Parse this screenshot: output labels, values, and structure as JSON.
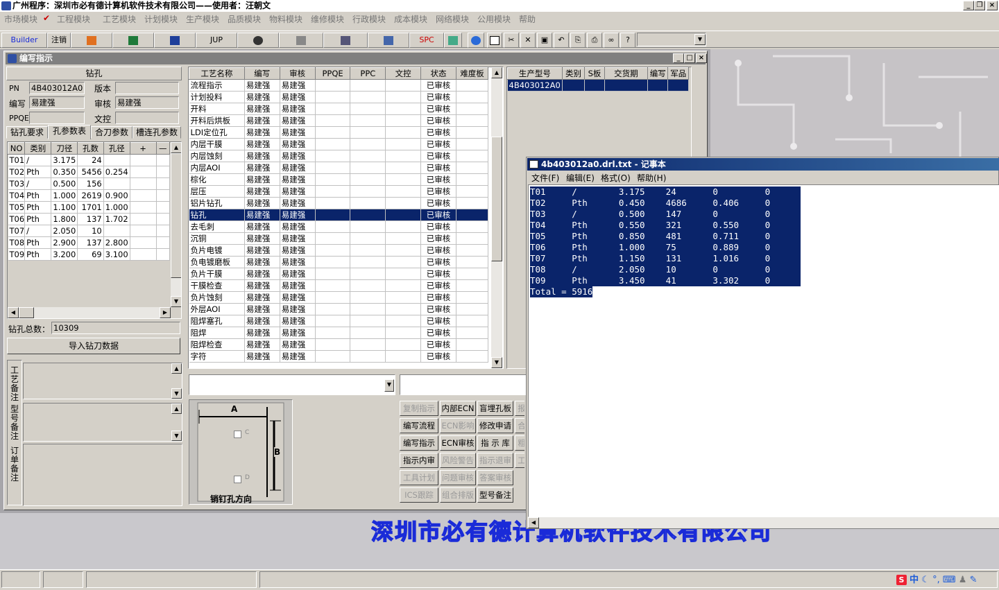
{
  "app_title": "广州程序：深圳市必有德计算机软件技术有限公司——使用者：汪朝文",
  "menu": [
    "市场模块",
    "工程模块",
    "工艺模块",
    "计划模块",
    "生产模块",
    "品质模块",
    "物料模块",
    "维修模块",
    "行政模块",
    "成本模块",
    "网络模块",
    "公用模块",
    "帮助"
  ],
  "toolbar": {
    "builder": "Builder",
    "logout": "注销",
    "jup": "JUP",
    "spc": "SPC"
  },
  "child_title": "编写指示",
  "left": {
    "section_title": "钻孔",
    "pn_label": "PN",
    "pn_value": "4B403012A0",
    "version_label": "版本",
    "version_value": "",
    "writer_label": "编写",
    "writer_value": "易建强",
    "reviewer_label": "审核",
    "reviewer_value": "易建强",
    "ppqe_label": "PPQE",
    "ppqe_value": "",
    "wenkong_label": "文控",
    "wenkong_value": "",
    "tabs": [
      "钻孔要求",
      "孔参数表",
      "合刀参数",
      "槽连孔参数"
    ],
    "table_headers": [
      "NO",
      "类别",
      "刀径",
      "孔数",
      "孔径",
      "+",
      "—"
    ],
    "rows": [
      [
        "T01",
        "/",
        "3.175",
        "24",
        ""
      ],
      [
        "T02",
        "Pth",
        "0.350",
        "5456",
        "0.254"
      ],
      [
        "T03",
        "/",
        "0.500",
        "156",
        ""
      ],
      [
        "T04",
        "Pth",
        "1.000",
        "2619",
        "0.900"
      ],
      [
        "T05",
        "Pth",
        "1.100",
        "1701",
        "1.000"
      ],
      [
        "T06",
        "Pth",
        "1.800",
        "137",
        "1.702"
      ],
      [
        "T07",
        "/",
        "2.050",
        "10",
        ""
      ],
      [
        "T08",
        "Pth",
        "2.900",
        "137",
        "2.800"
      ],
      [
        "T09",
        "Pth",
        "3.200",
        "69",
        "3.100"
      ]
    ],
    "total_label": "钻孔总数：",
    "total_value": "10309",
    "import_button": "导入钻刀数据",
    "note_labels": [
      "工艺备注",
      "型号备注",
      "订单备注"
    ]
  },
  "process": {
    "headers": [
      "工艺名称",
      "编写",
      "审核",
      "PPQE",
      "PPC",
      "文控",
      "状态",
      "难度板"
    ],
    "rows": [
      [
        "流程指示",
        "易建强",
        "易建强",
        "",
        "",
        "",
        "已审核",
        ""
      ],
      [
        "计划投料",
        "易建强",
        "易建强",
        "",
        "",
        "",
        "已审核",
        ""
      ],
      [
        "开料",
        "易建强",
        "易建强",
        "",
        "",
        "",
        "已审核",
        ""
      ],
      [
        "开料后烘板",
        "易建强",
        "易建强",
        "",
        "",
        "",
        "已审核",
        ""
      ],
      [
        "LDI定位孔",
        "易建强",
        "易建强",
        "",
        "",
        "",
        "已审核",
        ""
      ],
      [
        "内层干膜",
        "易建强",
        "易建强",
        "",
        "",
        "",
        "已审核",
        ""
      ],
      [
        "内层蚀刻",
        "易建强",
        "易建强",
        "",
        "",
        "",
        "已审核",
        ""
      ],
      [
        "内层AOI",
        "易建强",
        "易建强",
        "",
        "",
        "",
        "已审核",
        ""
      ],
      [
        "棕化",
        "易建强",
        "易建强",
        "",
        "",
        "",
        "已审核",
        ""
      ],
      [
        "层压",
        "易建强",
        "易建强",
        "",
        "",
        "",
        "已审核",
        ""
      ],
      [
        "铝片钻孔",
        "易建强",
        "易建强",
        "",
        "",
        "",
        "已审核",
        ""
      ],
      [
        "钻孔",
        "易建强",
        "易建强",
        "",
        "",
        "",
        "已审核",
        ""
      ],
      [
        "去毛刺",
        "易建强",
        "易建强",
        "",
        "",
        "",
        "已审核",
        ""
      ],
      [
        "沉铜",
        "易建强",
        "易建强",
        "",
        "",
        "",
        "已审核",
        ""
      ],
      [
        "负片电镀",
        "易建强",
        "易建强",
        "",
        "",
        "",
        "已审核",
        ""
      ],
      [
        "负电镀磨板",
        "易建强",
        "易建强",
        "",
        "",
        "",
        "已审核",
        ""
      ],
      [
        "负片干膜",
        "易建强",
        "易建强",
        "",
        "",
        "",
        "已审核",
        ""
      ],
      [
        "干膜检查",
        "易建强",
        "易建强",
        "",
        "",
        "",
        "已审核",
        ""
      ],
      [
        "负片蚀刻",
        "易建强",
        "易建强",
        "",
        "",
        "",
        "已审核",
        ""
      ],
      [
        "外层AOI",
        "易建强",
        "易建强",
        "",
        "",
        "",
        "已审核",
        ""
      ],
      [
        "阻焊塞孔",
        "易建强",
        "易建强",
        "",
        "",
        "",
        "已审核",
        ""
      ],
      [
        "阻焊",
        "易建强",
        "易建强",
        "",
        "",
        "",
        "已审核",
        ""
      ],
      [
        "阻焊检查",
        "易建强",
        "易建强",
        "",
        "",
        "",
        "已审核",
        ""
      ],
      [
        "字符",
        "易建强",
        "易建强",
        "",
        "",
        "",
        "已审核",
        ""
      ]
    ],
    "selected_index": 11
  },
  "orders": {
    "headers": [
      "生产型号",
      "类别",
      "S板",
      "交货期",
      "编写",
      "军品"
    ],
    "rows": [
      [
        "4B403012A0",
        "",
        "",
        "",
        "",
        ""
      ]
    ]
  },
  "diagram": {
    "label_a": "A",
    "label_b": "B",
    "check_c": "C",
    "check_d": "D",
    "caption": "销钉孔方向"
  },
  "action_buttons": [
    [
      "复制指示",
      "内部ECN",
      "盲埋孔板",
      "报"
    ],
    [
      "编写流程",
      "ECN影响",
      "修改申请",
      "合"
    ],
    [
      "编写指示",
      "ECN审核",
      "指 示 库",
      "粗"
    ],
    [
      "指示内审",
      "风险警告",
      "指示退审",
      "工"
    ],
    [
      "工具计划",
      "问题审核",
      "答案审核",
      ""
    ],
    [
      "ICS跟踪",
      "组合排版",
      "型号备注",
      ""
    ]
  ],
  "action_disabled": [
    [
      true,
      false,
      false,
      true
    ],
    [
      false,
      true,
      false,
      true
    ],
    [
      false,
      false,
      false,
      true
    ],
    [
      false,
      true,
      true,
      true
    ],
    [
      true,
      true,
      true,
      false
    ],
    [
      true,
      true,
      false,
      false
    ]
  ],
  "company_banner": "深圳市必有德计算机软件技术有限公司",
  "notepad": {
    "title": "4b403012a0.drl.txt - 记事本",
    "menu": [
      "文件(F)",
      "编辑(E)",
      "格式(O)",
      "帮助(H)"
    ],
    "lines": [
      "T01     /        3.175    24       0         0       0",
      "T02     Pth      0.450    4686     0.406     0       0",
      "T03     /        0.500    147      0         0       0",
      "T04     Pth      0.550    321      0.550     0       0",
      "T05     Pth      0.850    481      0.711     0       0",
      "T06     Pth      1.000    75       0.889     0       0",
      "T07     Pth      1.150    131      1.016     0       0",
      "T08     /        2.050    10       0         0       0",
      "T09     Pth      3.450    41       3.302     0       0",
      "Total = 5916"
    ]
  },
  "tray": {
    "ime": "中"
  },
  "colors": {
    "selection": "#0a246a",
    "banner": "#1a2bd8"
  }
}
